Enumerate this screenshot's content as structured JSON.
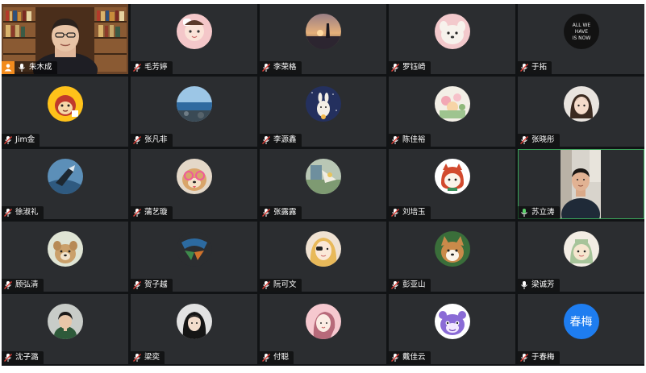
{
  "participants": [
    {
      "name": "朱木成",
      "tile": "video-host"
    },
    {
      "name": "毛芳婷",
      "tile": "avatar"
    },
    {
      "name": "李荣格",
      "tile": "avatar"
    },
    {
      "name": "罗钰崎",
      "tile": "avatar"
    },
    {
      "name": "于拓",
      "tile": "avatar"
    },
    {
      "name": "Jim金",
      "tile": "avatar"
    },
    {
      "name": "张凡非",
      "tile": "avatar"
    },
    {
      "name": "李源鑫",
      "tile": "avatar"
    },
    {
      "name": "陈佳裕",
      "tile": "avatar"
    },
    {
      "name": "张晓彤",
      "tile": "avatar"
    },
    {
      "name": "徐淑礼",
      "tile": "avatar"
    },
    {
      "name": "蒲艺璇",
      "tile": "avatar"
    },
    {
      "name": "张露露",
      "tile": "avatar"
    },
    {
      "name": "刘培玉",
      "tile": "avatar"
    },
    {
      "name": "苏立涛",
      "tile": "video-active"
    },
    {
      "name": "顾弘清",
      "tile": "avatar"
    },
    {
      "name": "贺子越",
      "tile": "avatar"
    },
    {
      "name": "阮可文",
      "tile": "avatar"
    },
    {
      "name": "彭亚山",
      "tile": "avatar"
    },
    {
      "name": "梁诚芳",
      "tile": "avatar"
    },
    {
      "name": "沈子潞",
      "tile": "avatar"
    },
    {
      "name": "梁奕",
      "tile": "avatar"
    },
    {
      "name": "付聪",
      "tile": "avatar"
    },
    {
      "name": "戴佳云",
      "tile": "avatar"
    },
    {
      "name": "于春梅",
      "tile": "text-avatar",
      "avatar_text": "春梅"
    }
  ],
  "avatar_poster_text": [
    "ALL WE",
    "HAVE",
    "IS NOW"
  ],
  "colors": {
    "tile_bg": "#2b2d30",
    "gap_bg": "#111315",
    "host_badge": "#f28b1d",
    "active_border": "#3aa55a",
    "text_avatar_bg": "#1e7df0",
    "muted_mic": "#e0413a",
    "active_mic": "#ffffff"
  },
  "icons": {
    "muted": "mic-muted-icon",
    "unmuted": "mic-icon",
    "host": "host-icon"
  }
}
